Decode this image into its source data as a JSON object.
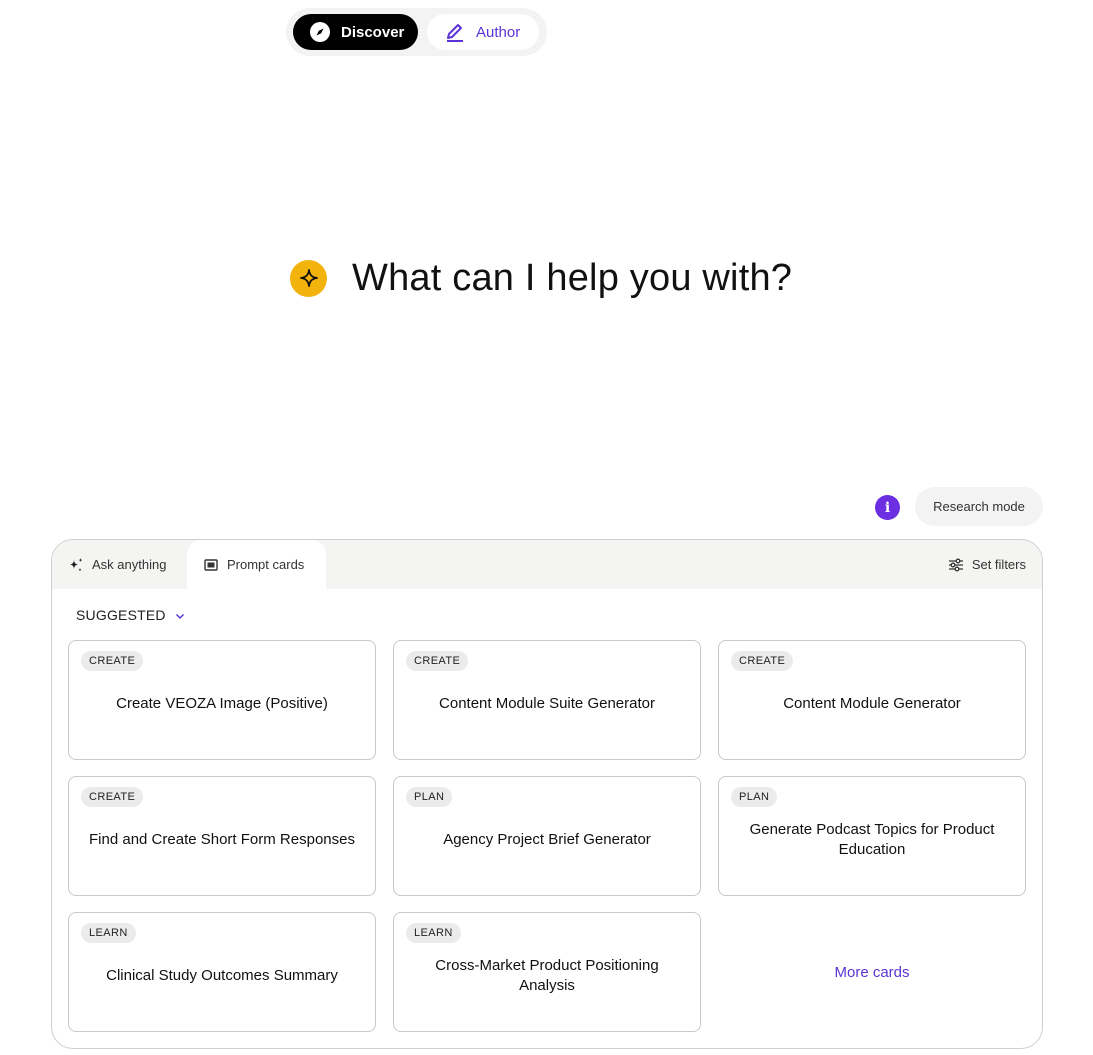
{
  "mode_toggle": {
    "discover_label": "Discover",
    "author_label": "Author"
  },
  "greeting": {
    "text": "What can I help you with?"
  },
  "research": {
    "info_glyph": "i",
    "label": "Research mode"
  },
  "tabs": {
    "ask_label": "Ask anything",
    "prompt_cards_label": "Prompt cards",
    "set_filters_label": "Set filters"
  },
  "suggested": {
    "label": "SUGGESTED"
  },
  "cards": [
    {
      "tag": "CREATE",
      "title": "Create VEOZA Image (Positive)"
    },
    {
      "tag": "CREATE",
      "title": "Content Module Suite Generator"
    },
    {
      "tag": "CREATE",
      "title": "Content Module Generator"
    },
    {
      "tag": "CREATE",
      "title": "Find and Create Short Form Responses"
    },
    {
      "tag": "PLAN",
      "title": "Agency Project Brief Generator"
    },
    {
      "tag": "PLAN",
      "title": "Generate Podcast Topics for Product Education"
    },
    {
      "tag": "LEARN",
      "title": "Clinical Study Outcomes Summary"
    },
    {
      "tag": "LEARN",
      "title": "Cross-Market Product Positioning Analysis"
    }
  ],
  "more_cards_label": "More cards",
  "colors": {
    "accent": "#5b34d6",
    "info_dot": "#6b2ee0",
    "star_badge": "#f2b30c"
  },
  "icons": {
    "discover": "compass-icon",
    "author": "pencil-icon",
    "greeting": "sparkle-star-icon",
    "ask": "sparkles-icon",
    "prompt_cards": "card-icon",
    "filters": "sliders-icon",
    "suggested": "chevron-down-icon"
  }
}
